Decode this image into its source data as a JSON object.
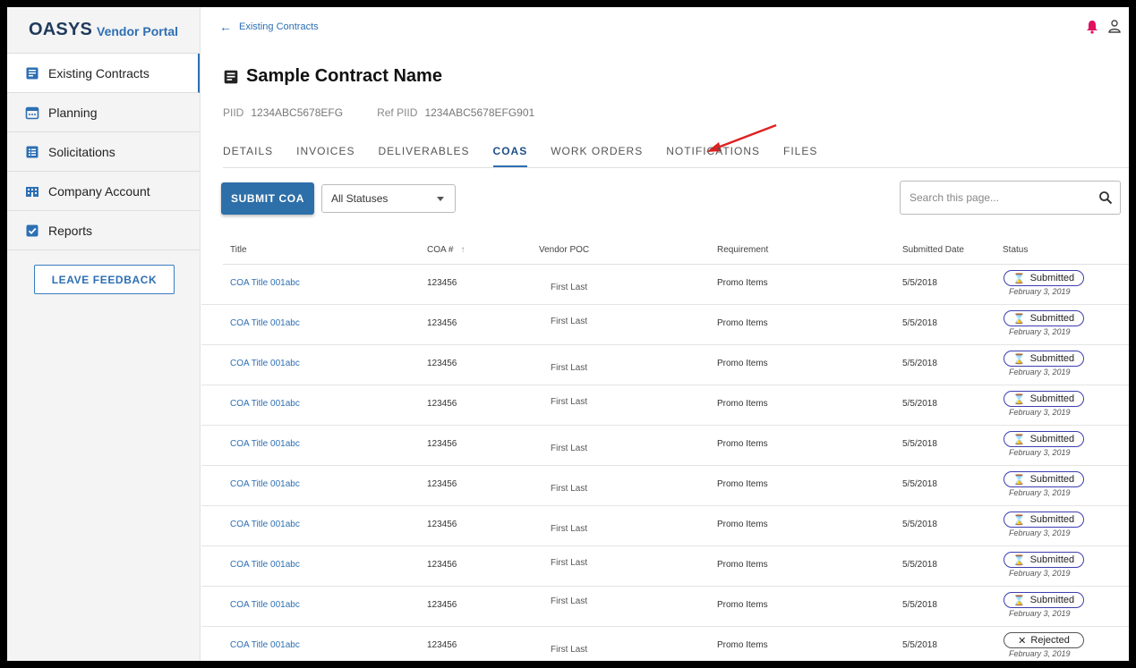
{
  "sidebar": {
    "brand_main": "OASYS",
    "brand_sub": "Vendor Portal",
    "items": [
      {
        "label": "Existing Contracts",
        "icon": "contract-icon"
      },
      {
        "label": "Planning",
        "icon": "calendar-icon"
      },
      {
        "label": "Solicitations",
        "icon": "list-icon"
      },
      {
        "label": "Company Account",
        "icon": "building-icon"
      },
      {
        "label": "Reports",
        "icon": "checkbox-icon"
      }
    ],
    "feedback_label": "LEAVE FEEDBACK"
  },
  "header": {
    "back_label": "Existing Contracts",
    "bell_icon": "bell-icon",
    "user_icon": "user-icon"
  },
  "contract": {
    "title": "Sample Contract Name",
    "piid_label": "PIID",
    "piid": "1234ABC5678EFG",
    "ref_piid_label": "Ref PIID",
    "ref_piid": "1234ABC5678EFG901"
  },
  "tabs": [
    "DETAILS",
    "INVOICES",
    "DELIVERABLES",
    "COAS",
    "WORK ORDERS",
    "NOTIFICATIONS",
    "FILES"
  ],
  "active_tab": "COAS",
  "toolbar": {
    "submit_label": "SUBMIT COA",
    "status_filter": "All Statuses",
    "search_placeholder": "Search this page..."
  },
  "table": {
    "columns": [
      "Title",
      "COA #",
      "Vendor POC",
      "Requirement",
      "Submitted Date",
      "Status"
    ],
    "rows": [
      {
        "title": "COA Title 001abc",
        "coa": "123456",
        "poc": "First Last",
        "requirement": "Promo Items",
        "date": "5/5/2018",
        "status": "Submitted",
        "status_date": "February 3, 2019"
      },
      {
        "title": "COA Title 001abc",
        "coa": "123456",
        "poc": "First Last",
        "requirement": "Promo Items",
        "date": "5/5/2018",
        "status": "Submitted",
        "status_date": "February 3, 2019"
      },
      {
        "title": "COA Title 001abc",
        "coa": "123456",
        "poc": "First Last",
        "requirement": "Promo Items",
        "date": "5/5/2018",
        "status": "Submitted",
        "status_date": "February 3, 2019"
      },
      {
        "title": "COA Title 001abc",
        "coa": "123456",
        "poc": "First Last",
        "requirement": "Promo Items",
        "date": "5/5/2018",
        "status": "Submitted",
        "status_date": "February 3, 2019"
      },
      {
        "title": "COA Title 001abc",
        "coa": "123456",
        "poc": "First Last",
        "requirement": "Promo Items",
        "date": "5/5/2018",
        "status": "Submitted",
        "status_date": "February 3, 2019"
      },
      {
        "title": "COA Title 001abc",
        "coa": "123456",
        "poc": "First Last",
        "requirement": "Promo Items",
        "date": "5/5/2018",
        "status": "Submitted",
        "status_date": "February 3, 2019"
      },
      {
        "title": "COA Title 001abc",
        "coa": "123456",
        "poc": "First Last",
        "requirement": "Promo Items",
        "date": "5/5/2018",
        "status": "Submitted",
        "status_date": "February 3, 2019"
      },
      {
        "title": "COA Title 001abc",
        "coa": "123456",
        "poc": "First Last",
        "requirement": "Promo Items",
        "date": "5/5/2018",
        "status": "Submitted",
        "status_date": "February 3, 2019"
      },
      {
        "title": "COA Title 001abc",
        "coa": "123456",
        "poc": "First Last",
        "requirement": "Promo Items",
        "date": "5/5/2018",
        "status": "Submitted",
        "status_date": "February 3, 2019"
      },
      {
        "title": "COA Title 001abc",
        "coa": "123456",
        "poc": "First Last",
        "requirement": "Promo Items",
        "date": "5/5/2018",
        "status": "Rejected",
        "status_date": "February 3, 2019"
      }
    ]
  },
  "colors": {
    "accent": "#2d6fb3",
    "brand": "#1f3a5c",
    "submitted_border": "#3d3db0",
    "annotation_arrow": "#e02020",
    "bell": "#e0115f"
  }
}
